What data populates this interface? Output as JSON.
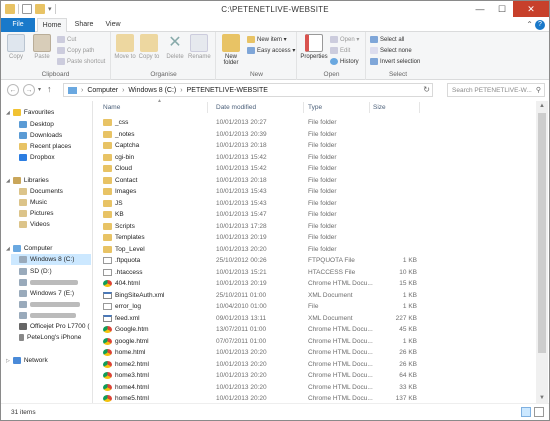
{
  "window": {
    "title": "C:\\PETENETLIVE-WEBSITE",
    "buttons": {
      "minimize": "—",
      "maximize": "☐",
      "close": "✕"
    }
  },
  "ribbon_tabs": [
    "File",
    "Home",
    "Share",
    "View"
  ],
  "ribbon": {
    "clipboard": {
      "label": "Clipboard",
      "copy": "Copy",
      "paste": "Paste",
      "cut": "Cut",
      "copy_path": "Copy path",
      "paste_shortcut": "Paste shortcut"
    },
    "organise": {
      "label": "Organise",
      "move_to": "Move to",
      "copy_to": "Copy to",
      "delete": "Delete",
      "rename": "Rename"
    },
    "new": {
      "label": "New",
      "new_folder": "New folder",
      "new_item": "New item ▾",
      "easy_access": "Easy access ▾"
    },
    "open": {
      "label": "Open",
      "properties": "Properties",
      "open": "Open ▾",
      "edit": "Edit",
      "history": "History"
    },
    "select": {
      "label": "Select",
      "select_all": "Select all",
      "select_none": "Select none",
      "invert_selection": "Invert selection"
    }
  },
  "address": {
    "path": [
      "Computer",
      "Windows 8 (C:)",
      "PETENETLIVE-WEBSITE"
    ],
    "search_placeholder": "Search PETENETLIVE-W..."
  },
  "nav": {
    "favourites": {
      "label": "Favourites",
      "items": [
        "Desktop",
        "Downloads",
        "Recent places",
        "Dropbox"
      ]
    },
    "libraries": {
      "label": "Libraries",
      "items": [
        "Documents",
        "Music",
        "Pictures",
        "Videos"
      ]
    },
    "computer": {
      "label": "Computer",
      "items": [
        "Windows 8 (C:)",
        "SD (D:)",
        "",
        "Windows 7 (E:)",
        "",
        "",
        "Officejet Pro L7700 (",
        "PeteLong's iPhone"
      ]
    },
    "network": {
      "label": "Network"
    }
  },
  "columns": {
    "name": "Name",
    "date": "Date modified",
    "type": "Type",
    "size": "Size"
  },
  "files": [
    {
      "icon": "folder",
      "name": "_css",
      "date": "10/01/2013 20:27",
      "type": "File folder",
      "size": ""
    },
    {
      "icon": "folder",
      "name": "_notes",
      "date": "10/01/2013 20:39",
      "type": "File folder",
      "size": ""
    },
    {
      "icon": "folder",
      "name": "Captcha",
      "date": "10/01/2013 20:18",
      "type": "File folder",
      "size": ""
    },
    {
      "icon": "folder",
      "name": "cgi-bin",
      "date": "10/01/2013 15:42",
      "type": "File folder",
      "size": ""
    },
    {
      "icon": "folder",
      "name": "Cloud",
      "date": "10/01/2013 15:42",
      "type": "File folder",
      "size": ""
    },
    {
      "icon": "folder",
      "name": "Contact",
      "date": "10/01/2013 20:18",
      "type": "File folder",
      "size": ""
    },
    {
      "icon": "folder",
      "name": "Images",
      "date": "10/01/2013 15:43",
      "type": "File folder",
      "size": ""
    },
    {
      "icon": "folder",
      "name": "JS",
      "date": "10/01/2013 15:43",
      "type": "File folder",
      "size": ""
    },
    {
      "icon": "folder",
      "name": "KB",
      "date": "10/01/2013 15:47",
      "type": "File folder",
      "size": ""
    },
    {
      "icon": "folder",
      "name": "Scripts",
      "date": "10/01/2013 17:28",
      "type": "File folder",
      "size": ""
    },
    {
      "icon": "folder",
      "name": "Templates",
      "date": "10/01/2013 20:19",
      "type": "File folder",
      "size": ""
    },
    {
      "icon": "folder",
      "name": "Top_Level",
      "date": "10/01/2013 20:20",
      "type": "File folder",
      "size": ""
    },
    {
      "icon": "file",
      "name": ".ftpquota",
      "date": "25/10/2012 00:26",
      "type": "FTPQUOTA File",
      "size": "1 KB"
    },
    {
      "icon": "file",
      "name": ".htaccess",
      "date": "10/01/2013 15:21",
      "type": "HTACCESS File",
      "size": "10 KB"
    },
    {
      "icon": "chrome",
      "name": "404.html",
      "date": "10/01/2013 20:19",
      "type": "Chrome HTML Docu...",
      "size": "15 KB"
    },
    {
      "icon": "xml",
      "name": "BingSiteAuth.xml",
      "date": "25/10/2011 01:00",
      "type": "XML Document",
      "size": "1 KB"
    },
    {
      "icon": "file",
      "name": "error_log",
      "date": "10/04/2010 01:00",
      "type": "File",
      "size": "1 KB"
    },
    {
      "icon": "xml",
      "name": "feed.xml",
      "date": "09/01/2013 13:11",
      "type": "XML Document",
      "size": "227 KB"
    },
    {
      "icon": "chrome",
      "name": "Google.htm",
      "date": "13/07/2011 01:00",
      "type": "Chrome HTML Docu...",
      "size": "45 KB"
    },
    {
      "icon": "chrome",
      "name": "google.html",
      "date": "07/07/2011 01:00",
      "type": "Chrome HTML Docu...",
      "size": "1 KB"
    },
    {
      "icon": "chrome",
      "name": "home.html",
      "date": "10/01/2013 20:20",
      "type": "Chrome HTML Docu...",
      "size": "26 KB"
    },
    {
      "icon": "chrome",
      "name": "home2.html",
      "date": "10/01/2013 20:20",
      "type": "Chrome HTML Docu...",
      "size": "26 KB"
    },
    {
      "icon": "chrome",
      "name": "home3.html",
      "date": "10/01/2013 20:20",
      "type": "Chrome HTML Docu...",
      "size": "64 KB"
    },
    {
      "icon": "chrome",
      "name": "home4.html",
      "date": "10/01/2013 20:20",
      "type": "Chrome HTML Docu...",
      "size": "33 KB"
    },
    {
      "icon": "chrome",
      "name": "home5.html",
      "date": "10/01/2013 20:20",
      "type": "Chrome HTML Docu...",
      "size": "137 KB"
    }
  ],
  "status": {
    "item_count": "31 items"
  },
  "colors": {
    "accent": "#1979ca",
    "selection": "#cce8ff",
    "folder": "#e8c365",
    "close": "#c7402b"
  }
}
